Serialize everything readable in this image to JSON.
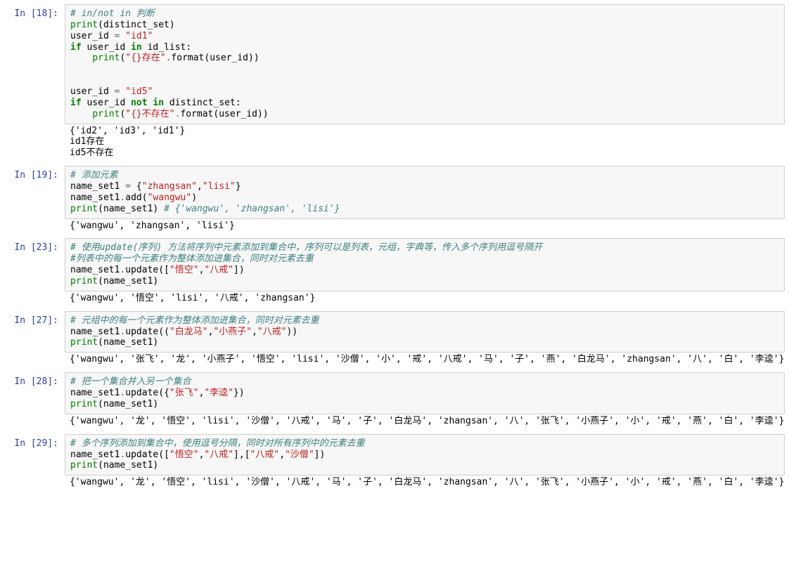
{
  "cells": [
    {
      "prompt": "In [18]:",
      "code_segments": [
        {
          "cls": "c-comment",
          "t": "# in/not in 判断"
        },
        {
          "t": "\n"
        },
        {
          "cls": "c-builtin",
          "t": "print"
        },
        {
          "t": "(distinct_set)"
        },
        {
          "t": "\n"
        },
        {
          "t": "user_id "
        },
        {
          "cls": "c-op",
          "t": "="
        },
        {
          "t": " "
        },
        {
          "cls": "c-string",
          "t": "\"id1\""
        },
        {
          "t": "\n"
        },
        {
          "cls": "c-keyword",
          "t": "if"
        },
        {
          "t": " user_id "
        },
        {
          "cls": "c-keyword",
          "t": "in"
        },
        {
          "t": " id_list:"
        },
        {
          "t": "\n"
        },
        {
          "t": "    "
        },
        {
          "cls": "c-builtin",
          "t": "print"
        },
        {
          "t": "("
        },
        {
          "cls": "c-string",
          "t": "\"{}存在\""
        },
        {
          "cls": "c-op",
          "t": "."
        },
        {
          "t": "format(user_id))"
        },
        {
          "t": "\n"
        },
        {
          "t": "\n"
        },
        {
          "t": "\n"
        },
        {
          "t": "user_id "
        },
        {
          "cls": "c-op",
          "t": "="
        },
        {
          "t": " "
        },
        {
          "cls": "c-string",
          "t": "\"id5\""
        },
        {
          "t": "\n"
        },
        {
          "cls": "c-keyword",
          "t": "if"
        },
        {
          "t": " user_id "
        },
        {
          "cls": "c-keyword",
          "t": "not"
        },
        {
          "t": " "
        },
        {
          "cls": "c-keyword",
          "t": "in"
        },
        {
          "t": " distinct_set:"
        },
        {
          "t": "\n"
        },
        {
          "t": "    "
        },
        {
          "cls": "c-builtin",
          "t": "print"
        },
        {
          "t": "("
        },
        {
          "cls": "c-string",
          "t": "\"{}不存在\""
        },
        {
          "cls": "c-op",
          "t": "."
        },
        {
          "t": "format(user_id))"
        }
      ],
      "output": "{'id2', 'id3', 'id1'}\nid1存在\nid5不存在"
    },
    {
      "prompt": "In [19]:",
      "code_segments": [
        {
          "cls": "c-comment",
          "t": "# 添加元素"
        },
        {
          "t": "\n"
        },
        {
          "t": "name_set1 "
        },
        {
          "cls": "c-op",
          "t": "="
        },
        {
          "t": " {"
        },
        {
          "cls": "c-string",
          "t": "\"zhangsan\""
        },
        {
          "t": ","
        },
        {
          "cls": "c-string",
          "t": "\"lisi\""
        },
        {
          "t": "}"
        },
        {
          "t": "\n"
        },
        {
          "t": "name_set1"
        },
        {
          "cls": "c-op",
          "t": "."
        },
        {
          "t": "add("
        },
        {
          "cls": "c-string",
          "t": "\"wangwu\""
        },
        {
          "t": ")"
        },
        {
          "t": "\n"
        },
        {
          "cls": "c-builtin",
          "t": "print"
        },
        {
          "t": "(name_set1) "
        },
        {
          "cls": "c-comment",
          "t": "# {'wangwu', 'zhangsan', 'lisi'}"
        }
      ],
      "output": "{'wangwu', 'zhangsan', 'lisi'}"
    },
    {
      "prompt": "In [23]:",
      "code_segments": [
        {
          "cls": "c-comment",
          "t": "# 使用update(序列) 方法将序列中元素添加到集合中，序列可以是列表，元组，字典等，传入多个序列用逗号隔开"
        },
        {
          "t": "\n"
        },
        {
          "cls": "c-comment",
          "t": "#列表中的每一个元素作为整体添加进集合，同时对元素去重"
        },
        {
          "t": "\n"
        },
        {
          "t": "name_set1"
        },
        {
          "cls": "c-op",
          "t": "."
        },
        {
          "t": "update(["
        },
        {
          "cls": "c-string",
          "t": "\"悟空\""
        },
        {
          "t": ","
        },
        {
          "cls": "c-string",
          "t": "\"八戒\""
        },
        {
          "t": "])"
        },
        {
          "t": "\n"
        },
        {
          "cls": "c-builtin",
          "t": "print"
        },
        {
          "t": "(name_set1)"
        }
      ],
      "output": "{'wangwu', '悟空', 'lisi', '八戒', 'zhangsan'}"
    },
    {
      "prompt": "In [27]:",
      "code_segments": [
        {
          "cls": "c-comment",
          "t": "# 元组中的每一个元素作为整体添加进集合，同时对元素去重"
        },
        {
          "t": "\n"
        },
        {
          "t": "name_set1"
        },
        {
          "cls": "c-op",
          "t": "."
        },
        {
          "t": "update(("
        },
        {
          "cls": "c-string",
          "t": "\"白龙马\""
        },
        {
          "t": ","
        },
        {
          "cls": "c-string",
          "t": "\"小燕子\""
        },
        {
          "t": ","
        },
        {
          "cls": "c-string",
          "t": "\"八戒\""
        },
        {
          "t": "))"
        },
        {
          "t": "\n"
        },
        {
          "cls": "c-builtin",
          "t": "print"
        },
        {
          "t": "(name_set1)"
        }
      ],
      "output": "{'wangwu', '张飞', '龙', '小燕子', '悟空', 'lisi', '沙僧', '小', '戒', '八戒', '马', '子', '燕', '白龙马', 'zhangsan', '八', '白', '李逵'}"
    },
    {
      "prompt": "In [28]:",
      "code_segments": [
        {
          "cls": "c-comment",
          "t": "# 把一个集合并入另一个集合"
        },
        {
          "t": "\n"
        },
        {
          "t": "name_set1"
        },
        {
          "cls": "c-op",
          "t": "."
        },
        {
          "t": "update({"
        },
        {
          "cls": "c-string",
          "t": "\"张飞\""
        },
        {
          "t": ","
        },
        {
          "cls": "c-string",
          "t": "\"李逵\""
        },
        {
          "t": "})"
        },
        {
          "t": "\n"
        },
        {
          "cls": "c-builtin",
          "t": "print"
        },
        {
          "t": "(name_set1)"
        }
      ],
      "output": "{'wangwu', '龙', '悟空', 'lisi', '沙僧', '八戒', '马', '子', '白龙马', 'zhangsan', '八', '张飞', '小燕子', '小', '戒', '燕', '白', '李逵'}"
    },
    {
      "prompt": "In [29]:",
      "code_segments": [
        {
          "cls": "c-comment",
          "t": "# 多个序列添加到集合中，使用逗号分隔，同时对所有序列中的元素去重"
        },
        {
          "t": "\n"
        },
        {
          "t": "name_set1"
        },
        {
          "cls": "c-op",
          "t": "."
        },
        {
          "t": "update(["
        },
        {
          "cls": "c-string",
          "t": "\"悟空\""
        },
        {
          "t": ","
        },
        {
          "cls": "c-string",
          "t": "\"八戒\""
        },
        {
          "t": "],["
        },
        {
          "cls": "c-string",
          "t": "\"八戒\""
        },
        {
          "t": ","
        },
        {
          "cls": "c-string",
          "t": "\"沙僧\""
        },
        {
          "t": "])"
        },
        {
          "t": "\n"
        },
        {
          "cls": "c-builtin",
          "t": "print"
        },
        {
          "t": "(name_set1)"
        }
      ],
      "output": "{'wangwu', '龙', '悟空', 'lisi', '沙僧', '八戒', '马', '子', '白龙马', 'zhangsan', '八', '张飞', '小燕子', '小', '戒', '燕', '白', '李逵'}"
    }
  ]
}
